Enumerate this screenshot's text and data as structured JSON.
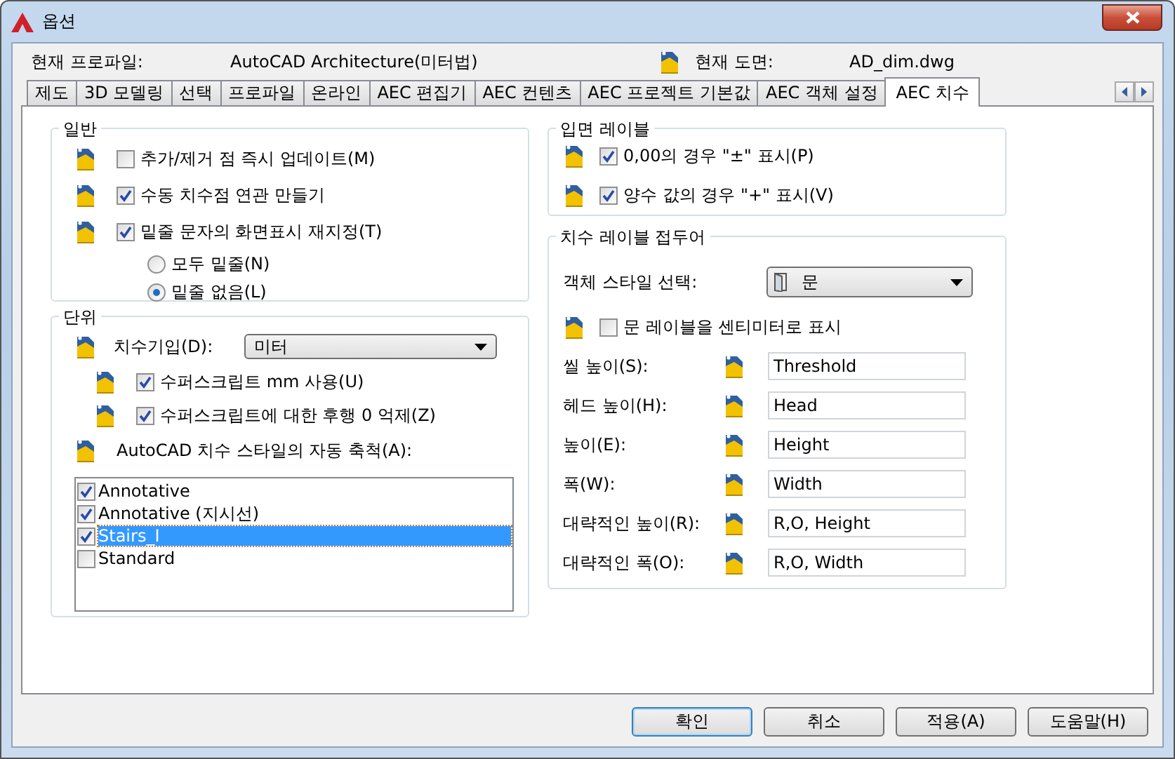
{
  "window": {
    "title": "옵션"
  },
  "profile": {
    "label": "현재 프로파일:",
    "value": "AutoCAD Architecture(미터법)"
  },
  "drawing": {
    "label": "현재 도면:",
    "value": "AD_dim.dwg"
  },
  "tabs": [
    {
      "label": "제도",
      "selected": false
    },
    {
      "label": "3D 모델링",
      "selected": false
    },
    {
      "label": "선택",
      "selected": false
    },
    {
      "label": "프로파일",
      "selected": false
    },
    {
      "label": "온라인",
      "selected": false
    },
    {
      "label": "AEC 편집기",
      "selected": false
    },
    {
      "label": "AEC 컨텐츠",
      "selected": false
    },
    {
      "label": "AEC 프로젝트 기본값",
      "selected": false
    },
    {
      "label": "AEC 객체 설정",
      "selected": false
    },
    {
      "label": "AEC 치수",
      "selected": true
    }
  ],
  "general": {
    "title": "일반",
    "options": [
      {
        "label": "추가/제거 점 즉시 업데이트(M)",
        "checked": false
      },
      {
        "label": "수동 치수점 연관 만들기",
        "checked": true
      },
      {
        "label": "밑줄 문자의 화면표시 재지정(T)",
        "checked": true
      }
    ],
    "radios": [
      {
        "label": "모두 밑줄(N)",
        "selected": false
      },
      {
        "label": "밑줄 없음(L)",
        "selected": true
      }
    ]
  },
  "units": {
    "title": "단위",
    "unit_label": "치수기입(D):",
    "unit_value": "미터",
    "options": [
      {
        "label": "수퍼스크립트 mm 사용(U)",
        "checked": true
      },
      {
        "label": "수퍼스크립트에 대한 후행 0 억제(Z)",
        "checked": true
      }
    ],
    "scale_label": "AutoCAD 치수 스타일의 자동 축척(A):",
    "styles": [
      {
        "label": "Annotative",
        "checked": true,
        "selected": false
      },
      {
        "label": "Annotative (지시선)",
        "checked": true,
        "selected": false
      },
      {
        "label": "Stairs_I",
        "checked": true,
        "selected": true
      },
      {
        "label": "Standard",
        "checked": false,
        "selected": false
      }
    ]
  },
  "elevation": {
    "title": "입면 레이블",
    "options": [
      {
        "label": "0,00의 경우 \"±\" 표시(P)",
        "checked": true
      },
      {
        "label": "양수 값의 경우 \"+\" 표시(V)",
        "checked": true
      }
    ]
  },
  "prefix": {
    "title": "치수 레이블 접두어",
    "style_label": "객체 스타일 선택:",
    "style_value": "문",
    "option": {
      "label": "문 레이블을 센티미터로 표시",
      "checked": false
    },
    "fields": [
      {
        "label": "씰 높이(S):",
        "value": "Threshold"
      },
      {
        "label": "헤드 높이(H):",
        "value": "Head"
      },
      {
        "label": "높이(E):",
        "value": "Height"
      },
      {
        "label": "폭(W):",
        "value": "Width"
      },
      {
        "label": "대략적인 높이(R):",
        "value": "R,O, Height"
      },
      {
        "label": "대략적인 폭(O):",
        "value": "R,O, Width"
      }
    ]
  },
  "buttons": [
    {
      "label": "확인",
      "default": true
    },
    {
      "label": "취소",
      "default": false
    },
    {
      "label": "적용(A)",
      "default": false
    },
    {
      "label": "도움말(H)",
      "default": false
    }
  ]
}
